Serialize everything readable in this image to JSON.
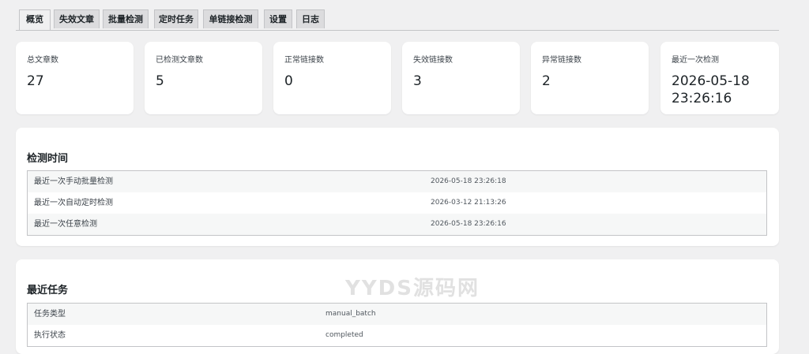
{
  "tabs": [
    "概览",
    "失效文章",
    "批量检测",
    "定时任务",
    "单链接检测",
    "设置",
    "日志"
  ],
  "cards": [
    {
      "label": "总文章数",
      "value": "27"
    },
    {
      "label": "已检测文章数",
      "value": "5"
    },
    {
      "label": "正常链接数",
      "value": "0"
    },
    {
      "label": "失效链接数",
      "value": "3"
    },
    {
      "label": "异常链接数",
      "value": "2"
    },
    {
      "label": "最近一次检测",
      "value": "2026-05-18 23:26:16"
    }
  ],
  "detect_time": {
    "title": "检测时间",
    "rows": [
      {
        "key": "最近一次手动批量检测",
        "value": "2026-05-18 23:26:18"
      },
      {
        "key": "最近一次自动定时检测",
        "value": "2026-03-12 21:13:26"
      },
      {
        "key": "最近一次任意检测",
        "value": "2026-05-18 23:26:16"
      }
    ]
  },
  "recent_task": {
    "title": "最近任务",
    "rows": [
      {
        "key": "任务类型",
        "value": "manual_batch"
      },
      {
        "key": "执行状态",
        "value": "completed"
      }
    ]
  },
  "watermark": "YYDS源码网"
}
